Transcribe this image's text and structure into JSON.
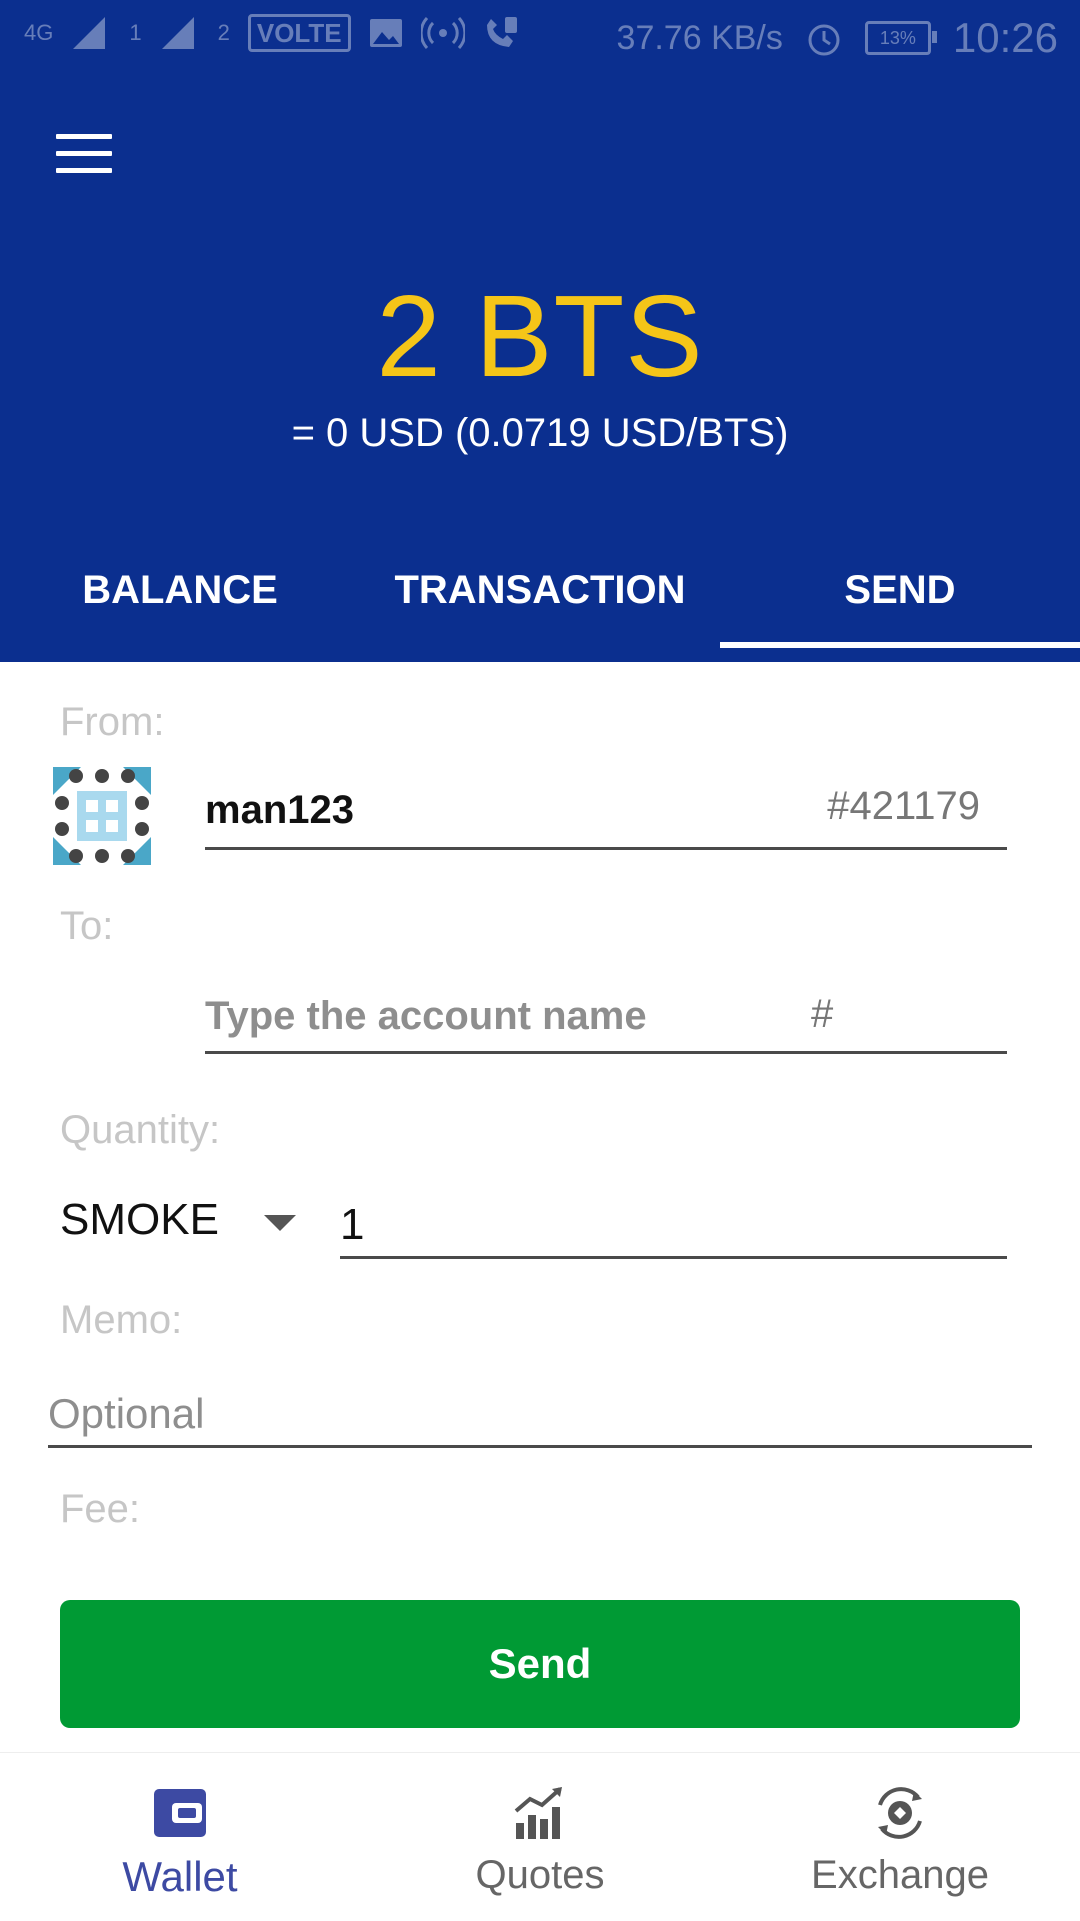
{
  "status_bar": {
    "network": "4G",
    "sim1": "1",
    "sim2": "2",
    "volte": "VOLTE",
    "speed": "37.76 KB/s",
    "battery": "13%",
    "time": "10:26"
  },
  "header": {
    "balance": "2 BTS",
    "balance_usd": "= 0 USD (0.0719 USD/BTS)"
  },
  "tabs": [
    {
      "label": "BALANCE",
      "active": false
    },
    {
      "label": "TRANSACTION",
      "active": false
    },
    {
      "label": "SEND",
      "active": true
    }
  ],
  "form": {
    "from_label": "From:",
    "from_account": "man123",
    "from_id": "#421179",
    "to_label": "To:",
    "to_placeholder": "Type the account name",
    "to_hash": "#",
    "quantity_label": "Quantity:",
    "asset": "SMOKE",
    "quantity": "1",
    "memo_label": "Memo:",
    "memo_placeholder": "Optional",
    "fee_label": "Fee:",
    "send_label": "Send"
  },
  "bottom_nav": [
    {
      "label": "Wallet",
      "icon": "wallet-icon",
      "active": true
    },
    {
      "label": "Quotes",
      "icon": "chart-icon",
      "active": false
    },
    {
      "label": "Exchange",
      "icon": "exchange-icon",
      "active": false
    }
  ],
  "colors": {
    "header_bg": "#0b2f8f",
    "balance": "#f5c518",
    "send_button": "#009a34",
    "active_nav": "#3d4aa3"
  }
}
